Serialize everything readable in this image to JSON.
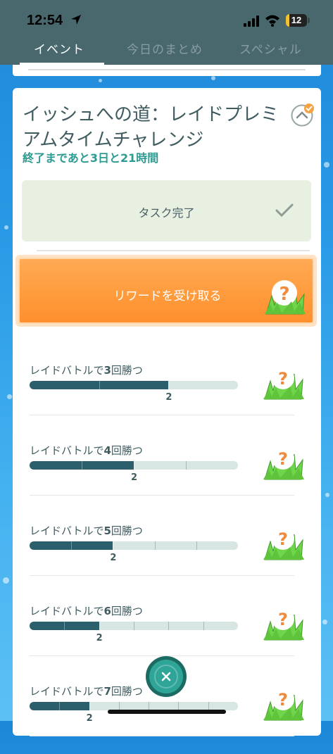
{
  "status_bar": {
    "time": "12:54",
    "battery": "12"
  },
  "tabs": [
    {
      "label": "イベント",
      "active": true
    },
    {
      "label": "今日のまとめ",
      "active": false
    },
    {
      "label": "スペシャル",
      "active": false
    }
  ],
  "research": {
    "title": "イッシュへの道：レイドプレミアムタイムチャレンジ",
    "time_left": "終了まであと3日と21時間",
    "task_done_label": "タスク完了",
    "reward_button_label": "リワードを受け取る",
    "reward_icon": "question-grass-icon",
    "tasks": [
      {
        "prefix": "レイドバトルで",
        "count": "3",
        "suffix": "回勝つ",
        "progress": 2,
        "goal": 3
      },
      {
        "prefix": "レイドバトルで",
        "count": "4",
        "suffix": "回勝つ",
        "progress": 2,
        "goal": 4
      },
      {
        "prefix": "レイドバトルで",
        "count": "5",
        "suffix": "回勝つ",
        "progress": 2,
        "goal": 5
      },
      {
        "prefix": "レイドバトルで",
        "count": "6",
        "suffix": "回勝つ",
        "progress": 2,
        "goal": 6
      },
      {
        "prefix": "レイドバトルで",
        "count": "7",
        "suffix": "回勝つ",
        "progress": 2,
        "goal": 7
      }
    ]
  },
  "colors": {
    "accent": "#ff9a3b",
    "teal": "#2d9b91",
    "header": "#48686e"
  }
}
